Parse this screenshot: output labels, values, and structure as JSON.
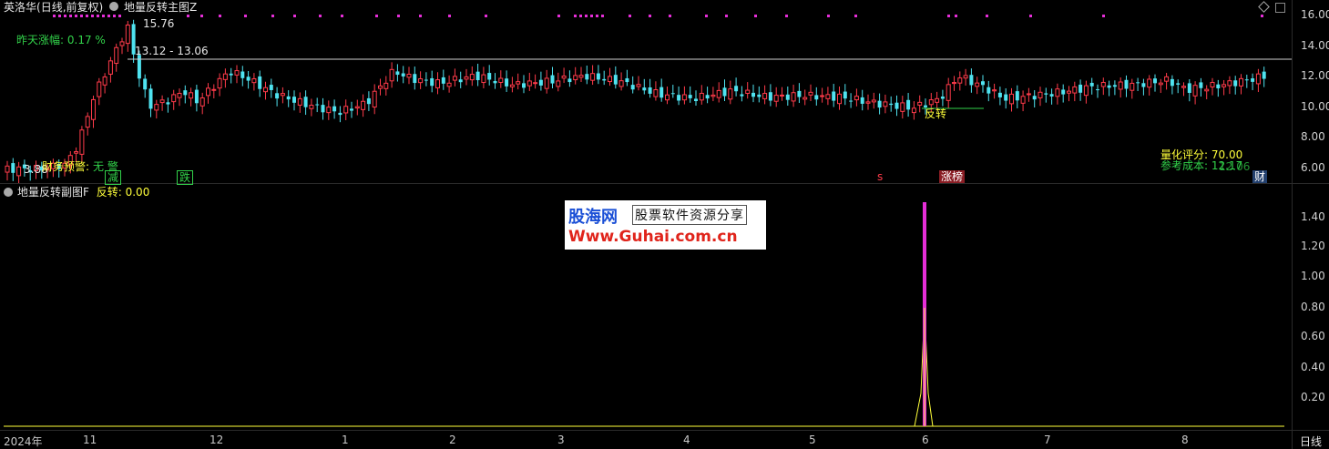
{
  "main": {
    "stock_name": "英洛华",
    "period": "(日线,前复权)",
    "indicator_name": "地量反转主图Z",
    "prev_change_label": "昨天涨幅:",
    "prev_change_value": "0.17 %",
    "high_label": "15.76",
    "range_label": "13.12 - 13.06",
    "low_label": "3.88",
    "finance_warning_label": "财务预警:",
    "finance_warning_value": "无 警",
    "tag_jian": "减",
    "tag_die": "跌",
    "tag_s": "s",
    "tag_zhangbang": "涨榜",
    "tag_reverse": "反转",
    "quant_label": "量化评分:",
    "quant_value": "70.00",
    "ref_label": "参考成本:",
    "ref_value": "12.17",
    "ref_value2": "12.06",
    "tag_cai": "财",
    "y_axis": [
      "16.00",
      "14.00",
      "12.00",
      "10.00",
      "8.00",
      "6.00"
    ]
  },
  "sub": {
    "indicator_name": "地量反转副图F",
    "reverse_label": "反转:",
    "reverse_value": "0.00",
    "y_axis": [
      "1.40",
      "1.20",
      "1.00",
      "0.80",
      "0.60",
      "0.40",
      "0.20"
    ]
  },
  "watermark": {
    "logo": "股海网",
    "subtitle": "股票软件资源分享",
    "url": "Www.Guhai.com.cn"
  },
  "x_axis": {
    "labels": [
      "2024年",
      "11",
      "12",
      "1",
      "2",
      "3",
      "4",
      "5",
      "6",
      "7",
      "8"
    ],
    "period_button": "日线"
  },
  "colors": {
    "up": "#ff3b4a",
    "down": "#4fe3f0",
    "magenta": "#e62ed8",
    "yellow": "#ffff3a",
    "green": "#32d24a"
  }
}
